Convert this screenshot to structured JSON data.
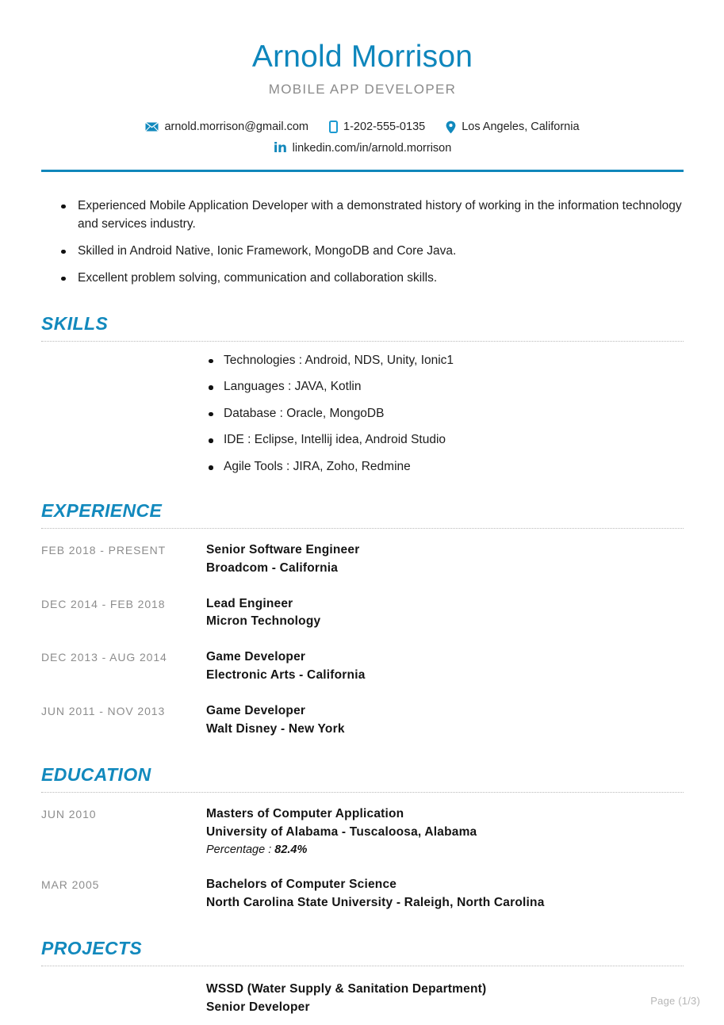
{
  "header": {
    "name": "Arnold Morrison",
    "job_title": "MOBILE APP DEVELOPER",
    "accent_color": "#1189bd",
    "contacts": [
      {
        "icon": "envelope-icon",
        "text": "arnold.morrison@gmail.com"
      },
      {
        "icon": "phone-icon",
        "text": "1-202-555-0135"
      },
      {
        "icon": "location-pin-icon",
        "text": "Los Angeles, California"
      }
    ],
    "linkedin": {
      "icon": "linkedin-icon",
      "text": "linkedin.com/in/arnold.morrison"
    }
  },
  "summary": {
    "bullets": [
      "Experienced Mobile Application Developer with a demonstrated history of working in the information technology and services industry.",
      "Skilled in Android Native, Ionic Framework, MongoDB and Core Java.",
      "Excellent problem solving, communication and collaboration skills."
    ]
  },
  "skills": {
    "title": "SKILLS",
    "items": [
      "Technologies : Android, NDS, Unity, Ionic1",
      "Languages : JAVA, Kotlin",
      "Database : Oracle, MongoDB",
      "IDE : Eclipse, Intellij idea, Android Studio",
      "Agile Tools : JIRA, Zoho, Redmine"
    ]
  },
  "experience": {
    "title": "EXPERIENCE",
    "entries": [
      {
        "date": "FEB 2018 - PRESENT",
        "role": "Senior Software Engineer",
        "company": "Broadcom - California"
      },
      {
        "date": "DEC 2014 - FEB 2018",
        "role": "Lead Engineer",
        "company": "Micron Technology"
      },
      {
        "date": "DEC 2013 - AUG 2014",
        "role": "Game Developer",
        "company": "Electronic Arts - California"
      },
      {
        "date": "JUN 2011 - NOV 2013",
        "role": "Game Developer",
        "company": "Walt Disney - New York"
      }
    ]
  },
  "education": {
    "title": "EDUCATION",
    "entries": [
      {
        "date": "JUN 2010",
        "degree": "Masters of Computer Application",
        "institution": "University of Alabama - Tuscaloosa, Alabama",
        "extra_label": "Percentage : ",
        "extra_value": "82.4%"
      },
      {
        "date": "MAR 2005",
        "degree": "Bachelors of Computer Science",
        "institution": "North Carolina State University - Raleigh, North Carolina",
        "extra_label": "",
        "extra_value": ""
      }
    ]
  },
  "projects": {
    "title": "PROJECTS",
    "entries": [
      {
        "date": "",
        "name": "WSSD (Water Supply & Sanitation Department)",
        "role": "Senior Developer"
      }
    ]
  },
  "footer": {
    "page_label": "Page (1/3)"
  }
}
